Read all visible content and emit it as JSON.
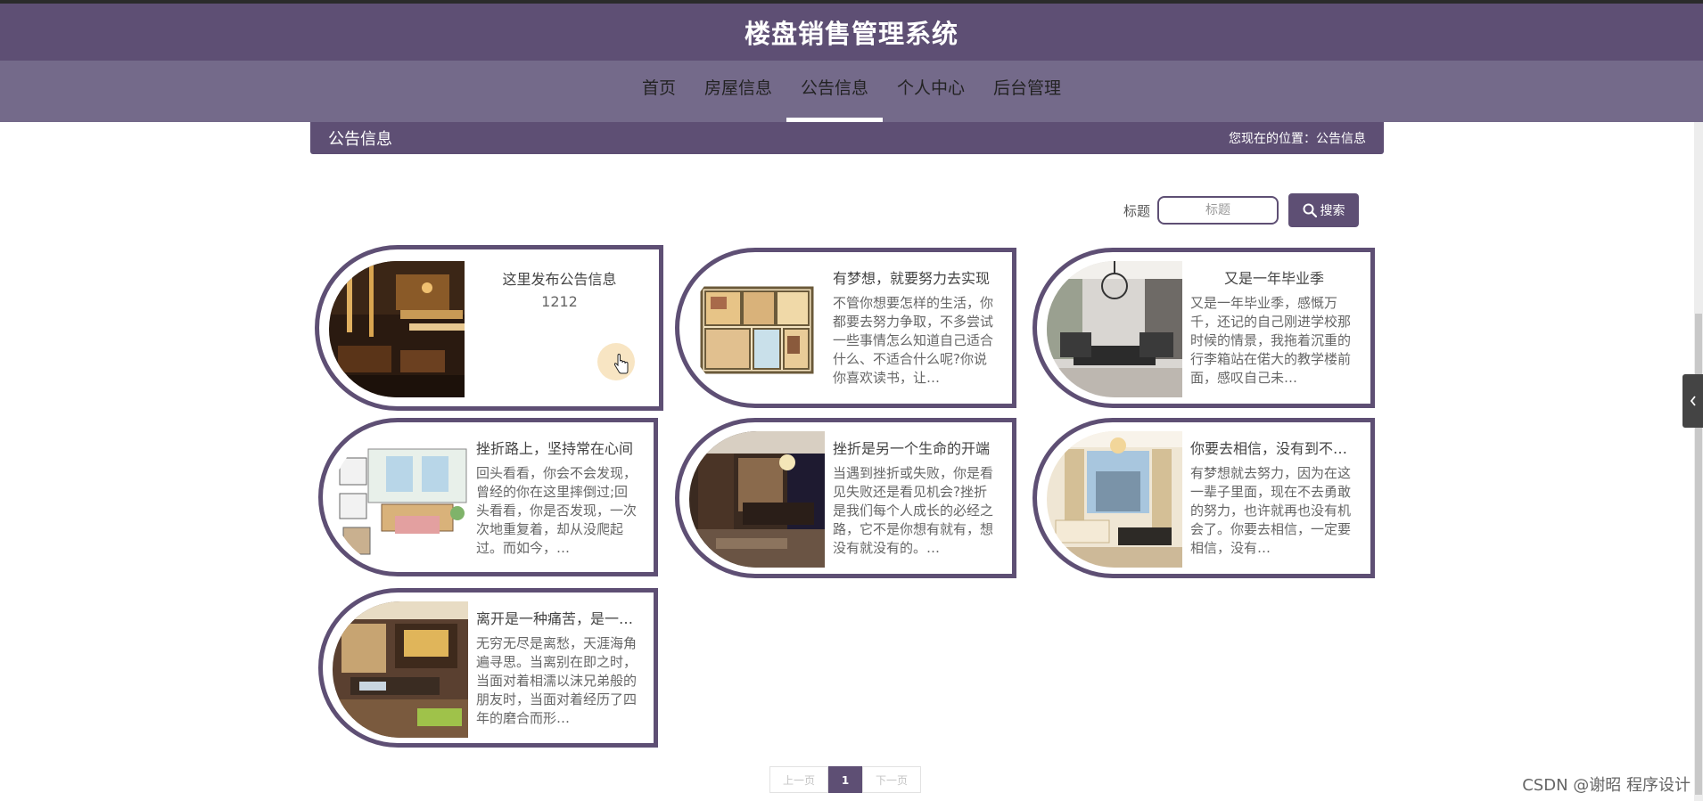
{
  "header": {
    "title": "楼盘销售管理系统"
  },
  "nav": {
    "items": [
      {
        "label": "首页",
        "active": false
      },
      {
        "label": "房屋信息",
        "active": false
      },
      {
        "label": "公告信息",
        "active": true
      },
      {
        "label": "个人中心",
        "active": false
      },
      {
        "label": "后台管理",
        "active": false
      }
    ]
  },
  "breadcrumb": {
    "section_title": "公告信息",
    "location": "您现在的位置：公告信息"
  },
  "search": {
    "label": "标题",
    "placeholder": "标题",
    "button_label": "搜索"
  },
  "cards": [
    {
      "title": "这里发布公告信息",
      "body": "1212",
      "image": "restaurant-interior"
    },
    {
      "title": "有梦想，就要努力去实现",
      "body": "不管你想要怎样的生活，你都要去努力争取，不多尝试一些事情怎么知道自己适合什么、不适合什么呢?你说你喜欢读书，让…",
      "image": "floor-plan"
    },
    {
      "title": "又是一年毕业季",
      "body": "又是一年毕业季，感慨万千，还记的自己刚进学校那时候的情景，我拖着沉重的行李箱站在偌大的教学楼前面，感叹自己未…",
      "image": "living-room-chandelier"
    },
    {
      "title": "挫折路上，坚持常在心间",
      "body": "回头看看，你会不会发现，曾经的你在这里摔倒过;回头看看，你是否发现，一次次地重复着，却从没爬起过。而如今，…",
      "image": "living-room-sketch"
    },
    {
      "title": "挫折是另一个生命的开端",
      "body": "当遇到挫折或失败，你是看见失败还是看见机会?挫折是我们每个人成长的必经之路，它不是你想有就有，想没有就没有的。…",
      "image": "bedroom"
    },
    {
      "title": "你要去相信，没有到不了的明天",
      "body": "有梦想就去努力，因为在这一辈子里面，现在不去勇敢的努力，也许就再也没有机会了。你要去相信，一定要相信，没有…",
      "image": "bright-living-room"
    },
    {
      "title": "离开是一种痛苦，是一种悲伤",
      "body": "无穷无尽是离愁，天涯海角遍寻思。当离别在即之时，当面对着相濡以沫兄弟般的朋友时，当面对着经历了四年的磨合而形…",
      "image": "dining-room"
    }
  ],
  "pagination": {
    "prev": "上一页",
    "current": "1",
    "next": "下一页"
  },
  "watermark": "CSDN @谢昭  程序设计",
  "colors": {
    "primary": "#5e4f74",
    "nav_bg": "#746a8a"
  }
}
